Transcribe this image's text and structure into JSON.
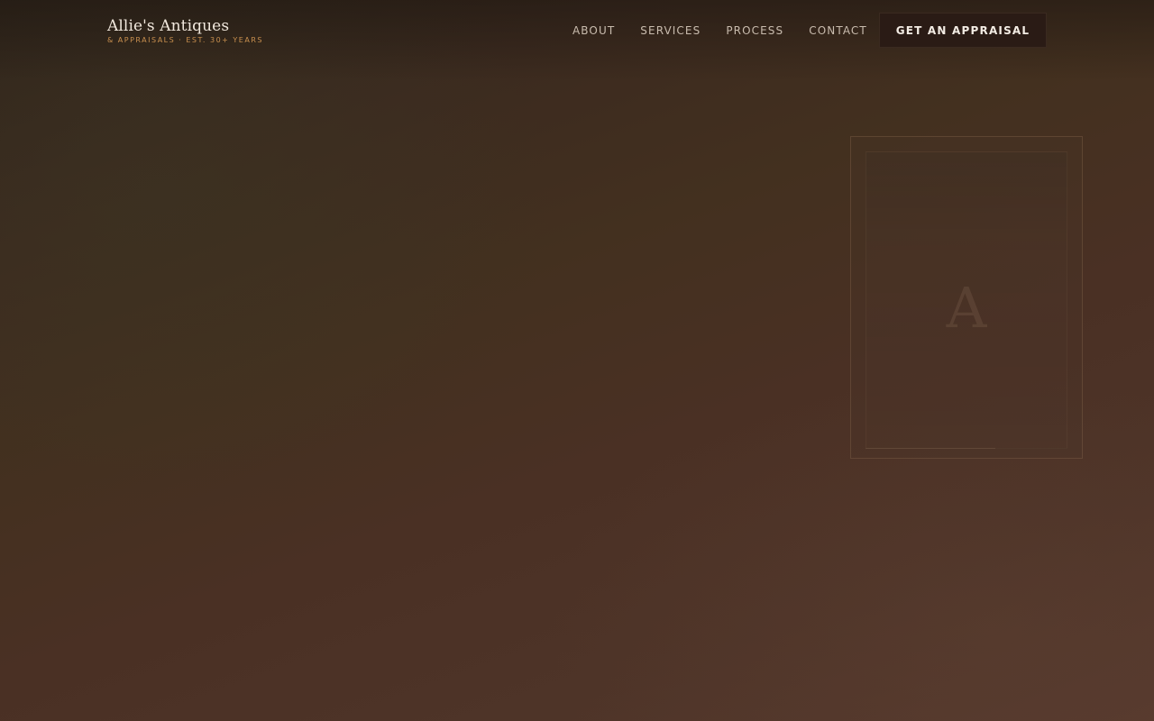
{
  "brand": {
    "name": "Allie's Antiques",
    "tagline": "& APPRAISALS · EST. 30+ YEARS"
  },
  "nav": {
    "items": [
      {
        "label": "ABOUT"
      },
      {
        "label": "SERVICES"
      },
      {
        "label": "PROCESS"
      },
      {
        "label": "CONTACT"
      }
    ],
    "cta_label": "GET AN APPRAISAL"
  },
  "hero": {
    "frame_monogram": "A"
  },
  "colors": {
    "accent": "#c9904f",
    "cta_background": "#2a1b15",
    "text_light": "#f1e8dd"
  }
}
